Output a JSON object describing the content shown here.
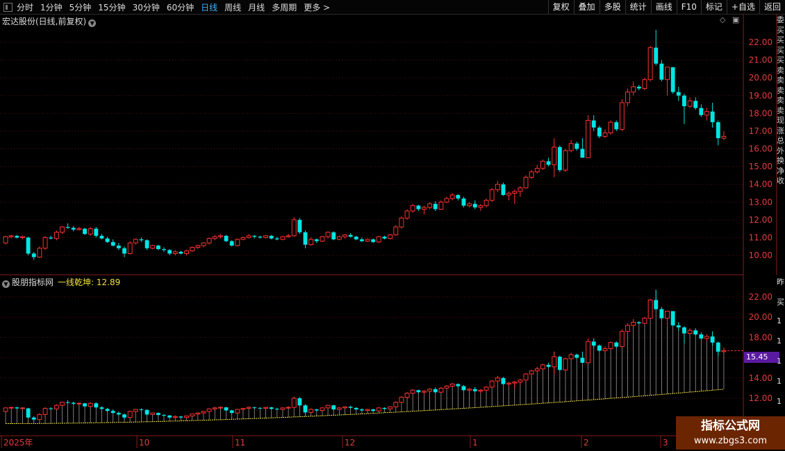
{
  "toolbar": {
    "periods": [
      "分时",
      "1分钟",
      "5分钟",
      "15分钟",
      "30分钟",
      "60分钟",
      "日线",
      "周线",
      "月线",
      "多周期",
      "更多 >"
    ],
    "active_period": "日线",
    "actions": [
      "复权",
      "叠加",
      "多股",
      "统计",
      "画线",
      "F10",
      "标记",
      "+自选",
      "返回"
    ]
  },
  "main_panel": {
    "title": "宏达股份(日线,前复权)",
    "axis_labels": [
      "22.00",
      "21.00",
      "20.00",
      "19.00",
      "18.00",
      "17.00",
      "16.00",
      "15.00",
      "14.00",
      "13.00",
      "12.00",
      "11.00",
      "10.00"
    ]
  },
  "indicator_panel": {
    "site": "股朋指标网",
    "indicator": "一线乾坤",
    "value": ": 12.89",
    "current_price": "15.45",
    "axis_labels": [
      "22.00",
      "20.00",
      "18.00",
      "16.00",
      "14.00",
      "12.00"
    ]
  },
  "x_axis": [
    "2025年",
    "10",
    "11",
    "12",
    "1",
    "2",
    "3"
  ],
  "right_strip_chars": [
    "委",
    "买",
    "买",
    "买",
    "买",
    "卖",
    "卖",
    "卖",
    "卖",
    "卖",
    "现",
    "涨",
    "总",
    "外",
    "换",
    "净",
    "收"
  ],
  "right_strip_chars2": [
    "昨",
    "买",
    "1",
    "1",
    "1",
    "1",
    "1",
    "1",
    "1"
  ],
  "watermark": {
    "line1": "指标公式网",
    "line2": "www.zbgs3.com"
  },
  "chart_data": {
    "type": "candlestick",
    "title": "宏达股份(日线,前复权)",
    "ylim": [
      9.5,
      23.0
    ],
    "up_color": "#ff3232",
    "down_color": "#00e5e5",
    "ohlc": [
      [
        10.7,
        11.1,
        10.6,
        11.05
      ],
      [
        11.05,
        11.15,
        10.95,
        11.1
      ],
      [
        11.1,
        11.15,
        10.95,
        11.0
      ],
      [
        11.0,
        11.1,
        10.9,
        11.05
      ],
      [
        11.0,
        11.05,
        10.0,
        10.1
      ],
      [
        10.1,
        10.2,
        9.75,
        9.9
      ],
      [
        9.9,
        10.5,
        9.85,
        10.4
      ],
      [
        10.4,
        11.1,
        10.3,
        11.0
      ],
      [
        11.0,
        11.1,
        10.9,
        10.95
      ],
      [
        10.95,
        11.4,
        10.85,
        11.3
      ],
      [
        11.3,
        11.65,
        11.2,
        11.6
      ],
      [
        11.6,
        11.8,
        11.5,
        11.55
      ],
      [
        11.55,
        11.65,
        11.35,
        11.45
      ],
      [
        11.45,
        11.6,
        11.4,
        11.5
      ],
      [
        11.5,
        11.55,
        11.15,
        11.2
      ],
      [
        11.2,
        11.6,
        11.1,
        11.5
      ],
      [
        11.5,
        11.6,
        11.0,
        11.1
      ],
      [
        11.1,
        11.2,
        10.9,
        10.95
      ],
      [
        10.95,
        11.05,
        10.7,
        10.75
      ],
      [
        10.75,
        10.9,
        10.5,
        10.55
      ],
      [
        10.55,
        10.7,
        10.3,
        10.4
      ],
      [
        10.4,
        10.5,
        9.9,
        10.1
      ],
      [
        10.1,
        10.8,
        10.05,
        10.7
      ],
      [
        10.7,
        10.95,
        10.6,
        10.9
      ],
      [
        10.9,
        11.0,
        10.75,
        10.85
      ],
      [
        10.85,
        10.9,
        10.3,
        10.4
      ],
      [
        10.4,
        10.6,
        10.35,
        10.55
      ],
      [
        10.55,
        10.6,
        10.3,
        10.35
      ],
      [
        10.35,
        10.45,
        10.2,
        10.3
      ],
      [
        10.3,
        10.35,
        10.0,
        10.1
      ],
      [
        10.1,
        10.3,
        10.0,
        10.2
      ],
      [
        10.2,
        10.25,
        10.05,
        10.1
      ],
      [
        10.1,
        10.3,
        10.0,
        10.25
      ],
      [
        10.25,
        10.5,
        10.2,
        10.45
      ],
      [
        10.45,
        10.6,
        10.35,
        10.55
      ],
      [
        10.55,
        10.75,
        10.45,
        10.7
      ],
      [
        10.7,
        11.0,
        10.6,
        10.95
      ],
      [
        10.95,
        11.15,
        10.85,
        11.05
      ],
      [
        11.05,
        11.2,
        10.95,
        11.1
      ],
      [
        11.1,
        11.15,
        10.75,
        10.8
      ],
      [
        10.8,
        10.85,
        10.5,
        10.55
      ],
      [
        10.55,
        10.95,
        10.5,
        10.9
      ],
      [
        10.9,
        11.05,
        10.85,
        11.0
      ],
      [
        11.0,
        11.2,
        10.95,
        11.1
      ],
      [
        11.1,
        11.15,
        10.95,
        11.05
      ],
      [
        11.05,
        11.1,
        10.95,
        11.0
      ],
      [
        11.0,
        11.15,
        10.95,
        11.1
      ],
      [
        11.1,
        11.15,
        10.9,
        10.95
      ],
      [
        10.95,
        11.05,
        10.85,
        10.9
      ],
      [
        10.9,
        11.1,
        10.85,
        11.05
      ],
      [
        11.05,
        11.2,
        11.0,
        11.1
      ],
      [
        11.1,
        12.15,
        11.05,
        12.0
      ],
      [
        12.0,
        12.1,
        11.2,
        11.3
      ],
      [
        11.3,
        11.4,
        10.4,
        10.6
      ],
      [
        10.6,
        11.0,
        10.55,
        10.9
      ],
      [
        10.9,
        10.95,
        10.7,
        10.8
      ],
      [
        10.8,
        11.1,
        10.75,
        11.05
      ],
      [
        11.05,
        11.35,
        10.95,
        11.3
      ],
      [
        11.3,
        11.35,
        10.85,
        10.9
      ],
      [
        10.9,
        11.1,
        10.85,
        11.05
      ],
      [
        11.05,
        11.2,
        10.95,
        11.15
      ],
      [
        11.15,
        11.25,
        11.0,
        11.05
      ],
      [
        11.05,
        11.1,
        10.85,
        10.9
      ],
      [
        10.9,
        11.0,
        10.75,
        10.8
      ],
      [
        10.8,
        10.95,
        10.75,
        10.9
      ],
      [
        10.9,
        10.95,
        10.7,
        10.75
      ],
      [
        10.75,
        11.1,
        10.7,
        11.05
      ],
      [
        11.05,
        11.1,
        10.9,
        10.95
      ],
      [
        10.95,
        11.2,
        10.9,
        11.15
      ],
      [
        11.15,
        11.7,
        11.1,
        11.6
      ],
      [
        11.6,
        12.2,
        11.5,
        12.1
      ],
      [
        12.1,
        12.6,
        12.0,
        12.5
      ],
      [
        12.5,
        12.9,
        12.4,
        12.8
      ],
      [
        12.8,
        12.85,
        12.5,
        12.6
      ],
      [
        12.6,
        12.8,
        12.3,
        12.7
      ],
      [
        12.7,
        13.0,
        12.6,
        12.9
      ],
      [
        12.9,
        13.05,
        12.5,
        12.6
      ],
      [
        12.6,
        13.1,
        12.55,
        13.0
      ],
      [
        13.0,
        13.3,
        12.95,
        13.2
      ],
      [
        13.2,
        13.5,
        13.1,
        13.4
      ],
      [
        13.4,
        13.45,
        13.1,
        13.2
      ],
      [
        13.2,
        13.3,
        12.7,
        12.8
      ],
      [
        12.8,
        13.0,
        12.7,
        12.9
      ],
      [
        12.9,
        13.1,
        12.6,
        12.7
      ],
      [
        12.7,
        12.9,
        12.5,
        12.8
      ],
      [
        12.8,
        13.2,
        12.7,
        13.1
      ],
      [
        13.1,
        13.8,
        13.0,
        13.7
      ],
      [
        13.7,
        14.2,
        13.55,
        14.0
      ],
      [
        14.0,
        14.1,
        13.35,
        13.4
      ],
      [
        13.4,
        13.6,
        13.1,
        13.5
      ],
      [
        13.5,
        13.7,
        12.9,
        13.6
      ],
      [
        13.6,
        13.9,
        13.3,
        13.8
      ],
      [
        13.8,
        14.5,
        13.75,
        14.4
      ],
      [
        14.4,
        14.8,
        14.3,
        14.7
      ],
      [
        14.7,
        15.1,
        14.6,
        14.9
      ],
      [
        14.9,
        15.4,
        14.8,
        15.3
      ],
      [
        15.3,
        15.5,
        15.0,
        15.1
      ],
      [
        15.1,
        16.6,
        14.4,
        16.1
      ],
      [
        16.1,
        16.2,
        14.7,
        14.8
      ],
      [
        14.8,
        16.0,
        14.7,
        15.9
      ],
      [
        15.9,
        16.5,
        15.8,
        16.3
      ],
      [
        16.3,
        16.4,
        15.9,
        16.0
      ],
      [
        16.0,
        16.6,
        15.5,
        15.5
      ],
      [
        15.5,
        17.9,
        15.5,
        17.6
      ],
      [
        17.6,
        17.9,
        17.0,
        17.2
      ],
      [
        17.2,
        17.3,
        16.6,
        16.7
      ],
      [
        16.7,
        17.1,
        16.6,
        16.9
      ],
      [
        16.9,
        17.6,
        16.8,
        17.5
      ],
      [
        17.5,
        17.6,
        17.0,
        17.1
      ],
      [
        17.1,
        18.8,
        17.0,
        18.6
      ],
      [
        18.6,
        19.4,
        18.4,
        19.2
      ],
      [
        19.2,
        19.8,
        19.0,
        19.5
      ],
      [
        19.5,
        19.6,
        19.3,
        19.4
      ],
      [
        19.4,
        20.0,
        19.3,
        19.9
      ],
      [
        19.9,
        21.8,
        19.8,
        21.7
      ],
      [
        21.7,
        22.7,
        20.7,
        20.8
      ],
      [
        20.8,
        21.0,
        19.8,
        19.9
      ],
      [
        19.9,
        20.6,
        19.0,
        20.6
      ],
      [
        20.6,
        20.6,
        19.1,
        19.2
      ],
      [
        19.2,
        19.5,
        18.7,
        19.0
      ],
      [
        19.0,
        19.1,
        17.4,
        18.4
      ],
      [
        18.4,
        18.9,
        18.3,
        18.7
      ],
      [
        18.7,
        18.9,
        18.2,
        18.3
      ],
      [
        18.3,
        18.5,
        17.8,
        17.9
      ],
      [
        17.9,
        18.3,
        17.6,
        18.1
      ],
      [
        18.1,
        18.6,
        17.2,
        17.5
      ],
      [
        17.5,
        17.6,
        16.2,
        16.6
      ],
      [
        16.6,
        17.0,
        16.5,
        16.7
      ]
    ],
    "indicator_line_start": 9.5,
    "indicator_line_end": 12.89,
    "x_labels": [
      "2025年",
      "10",
      "11",
      "12",
      "1",
      "2",
      "3"
    ]
  }
}
